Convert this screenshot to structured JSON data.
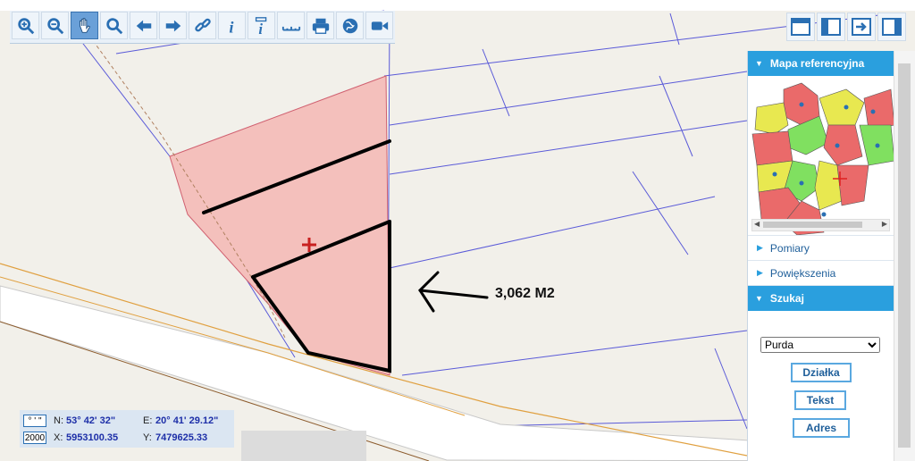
{
  "toolbar": {
    "tools": [
      {
        "name": "zoom-in-icon",
        "glyph": "zoom-in"
      },
      {
        "name": "zoom-out-icon",
        "glyph": "zoom-out"
      },
      {
        "name": "pan-hand-icon",
        "glyph": "hand",
        "active": true
      },
      {
        "name": "zoom-extent-icon",
        "glyph": "zoom"
      },
      {
        "name": "arrow-left-icon",
        "glyph": "left"
      },
      {
        "name": "arrow-right-icon",
        "glyph": "right"
      },
      {
        "name": "link-icon",
        "glyph": "link"
      },
      {
        "name": "info-icon",
        "glyph": "i"
      },
      {
        "name": "info-edit-icon",
        "glyph": "i2"
      },
      {
        "name": "ruler-icon",
        "glyph": "ruler"
      },
      {
        "name": "print-icon",
        "glyph": "print"
      },
      {
        "name": "globe-icon",
        "glyph": "globe"
      },
      {
        "name": "video-icon",
        "glyph": "video"
      }
    ],
    "accent": "#2a6fb3"
  },
  "panel": {
    "reference_map_title": "Mapa referencyjna",
    "measurements_label": "Pomiary",
    "zooms_label": "Powiększenia",
    "search_title": "Szukaj",
    "search_select_value": "Purda",
    "button_parcel": "Działka",
    "button_text": "Tekst",
    "button_address": "Adres",
    "header_color": "#2a9fde"
  },
  "coords": {
    "dms_label": "° ' \"",
    "scale_label": "2000",
    "n_label": "N:",
    "n_value": "53° 42' 32\"",
    "e_label": "E:",
    "e_value": "20° 41' 29.12\"",
    "x_label": "X:",
    "x_value": "5953100.35",
    "y_label": "Y:",
    "y_value": "7479625.33"
  },
  "map": {
    "annotation_text": "3,062 M2",
    "parcel_fill": "#f4c0bc",
    "background": "#f1efe9"
  }
}
